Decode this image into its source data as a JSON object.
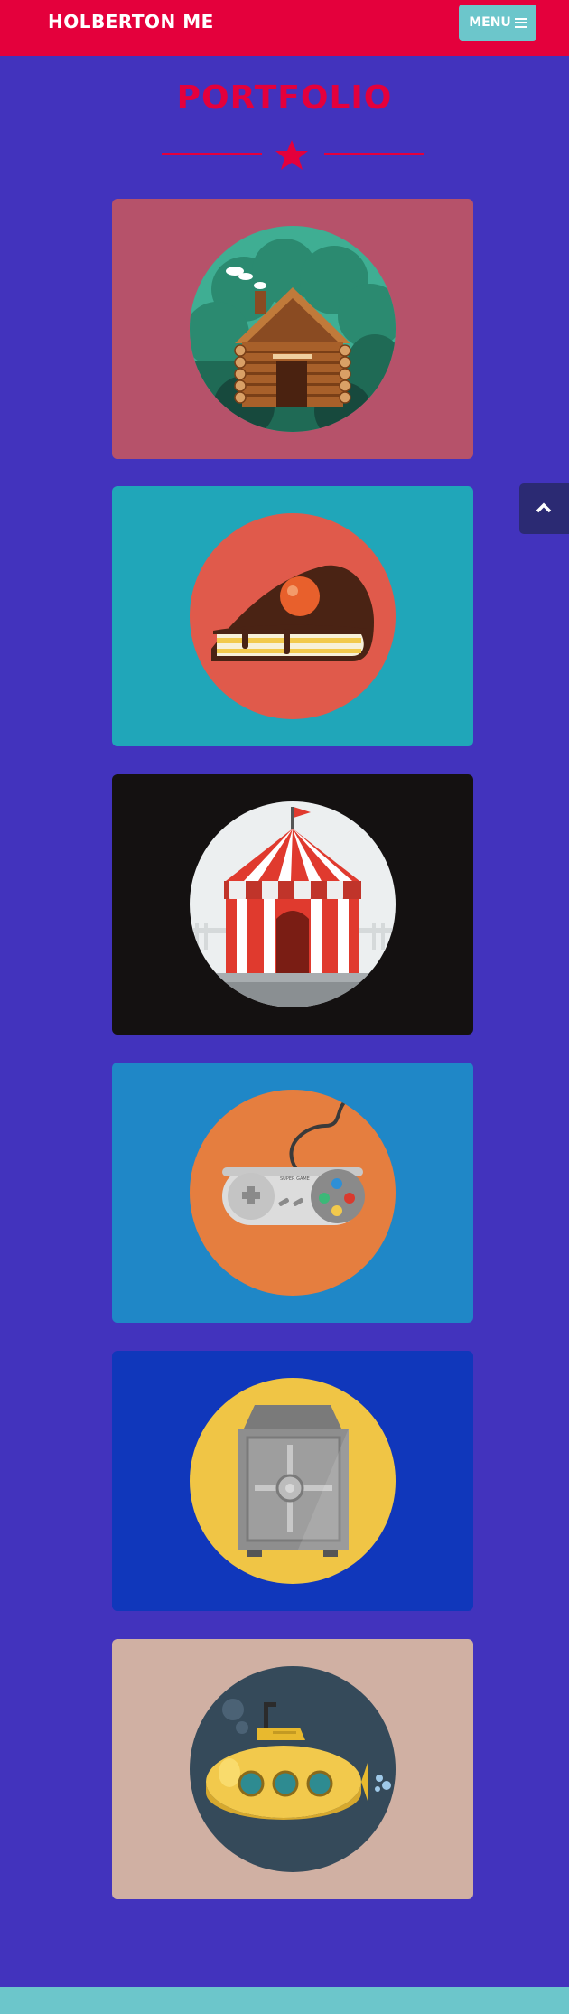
{
  "navbar": {
    "brand": "HOLBERTON ME",
    "menu_label": "MENU",
    "menu_icon": "bars-icon"
  },
  "portfolio": {
    "title": "PORTFOLIO",
    "divider_icon": "star-icon",
    "items": [
      {
        "icon": "log-cabin-icon",
        "color": "#b6526a"
      },
      {
        "icon": "cake-slice-icon",
        "color": "#20a6b9"
      },
      {
        "icon": "circus-tent-icon",
        "color": "#141111"
      },
      {
        "icon": "game-controller-icon",
        "color": "#1f87c7"
      },
      {
        "icon": "safe-icon",
        "color": "#1037bb"
      },
      {
        "icon": "submarine-icon",
        "color": "#d0b0a3"
      }
    ],
    "controller_brand": "SUPER GAME"
  },
  "scroll_top_icon": "chevron-up-icon",
  "colors": {
    "background": "#4233bd",
    "accent": "#e4003c",
    "teal": "#6cc6cb"
  }
}
